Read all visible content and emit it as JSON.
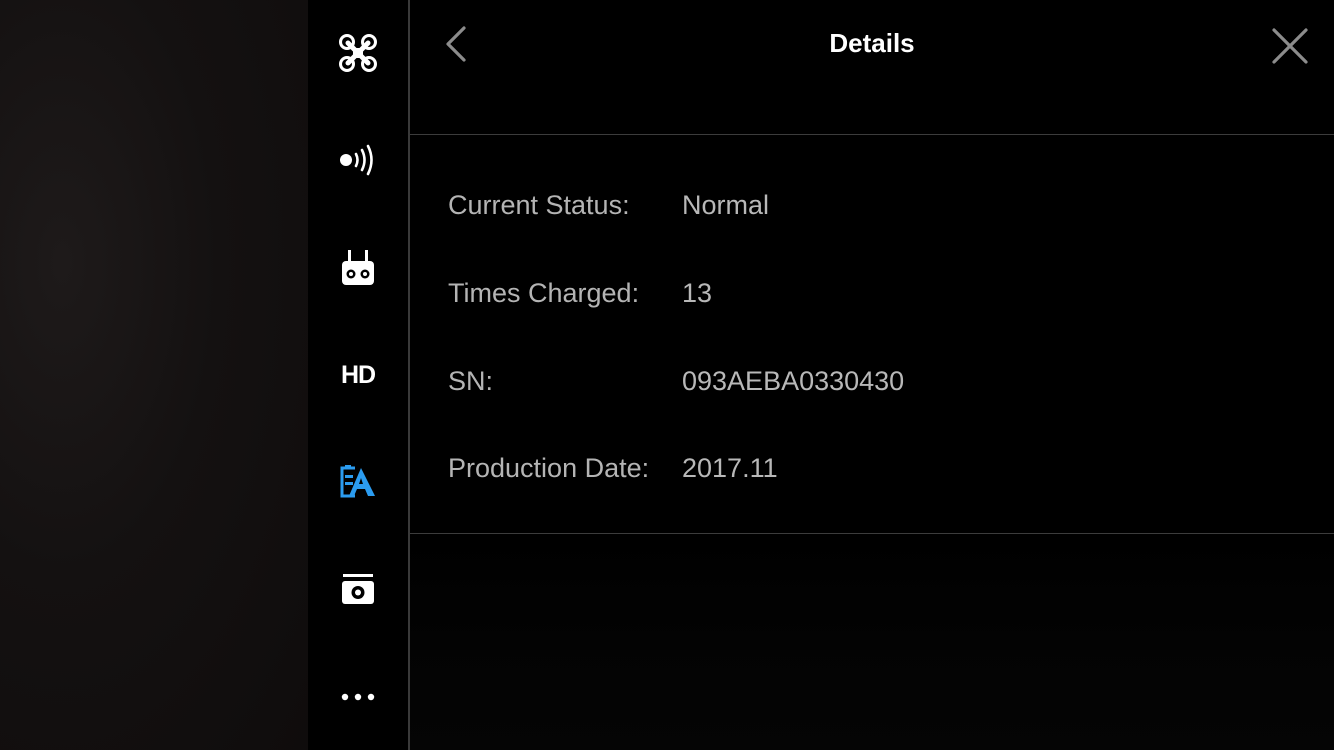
{
  "header": {
    "title": "Details"
  },
  "sidebar": {
    "items": [
      {
        "name": "aircraft",
        "icon": "drone-icon"
      },
      {
        "name": "sensing",
        "icon": "signal-icon"
      },
      {
        "name": "remote-controller",
        "icon": "remote-controller-icon"
      },
      {
        "name": "transmission",
        "label": "HD"
      },
      {
        "name": "battery",
        "icon": "battery-icon",
        "active": true
      },
      {
        "name": "camera",
        "icon": "camera-icon"
      },
      {
        "name": "more",
        "icon": "more-icon"
      }
    ],
    "active_color": "#2b9cf0",
    "icon_color": "#ffffff"
  },
  "details": {
    "rows": [
      {
        "label": "Current Status:",
        "value": "Normal"
      },
      {
        "label": "Times Charged:",
        "value": "13"
      },
      {
        "label": "SN:",
        "value": "093AEBA0330430"
      },
      {
        "label": "Production Date:",
        "value": "2017.11"
      }
    ]
  }
}
